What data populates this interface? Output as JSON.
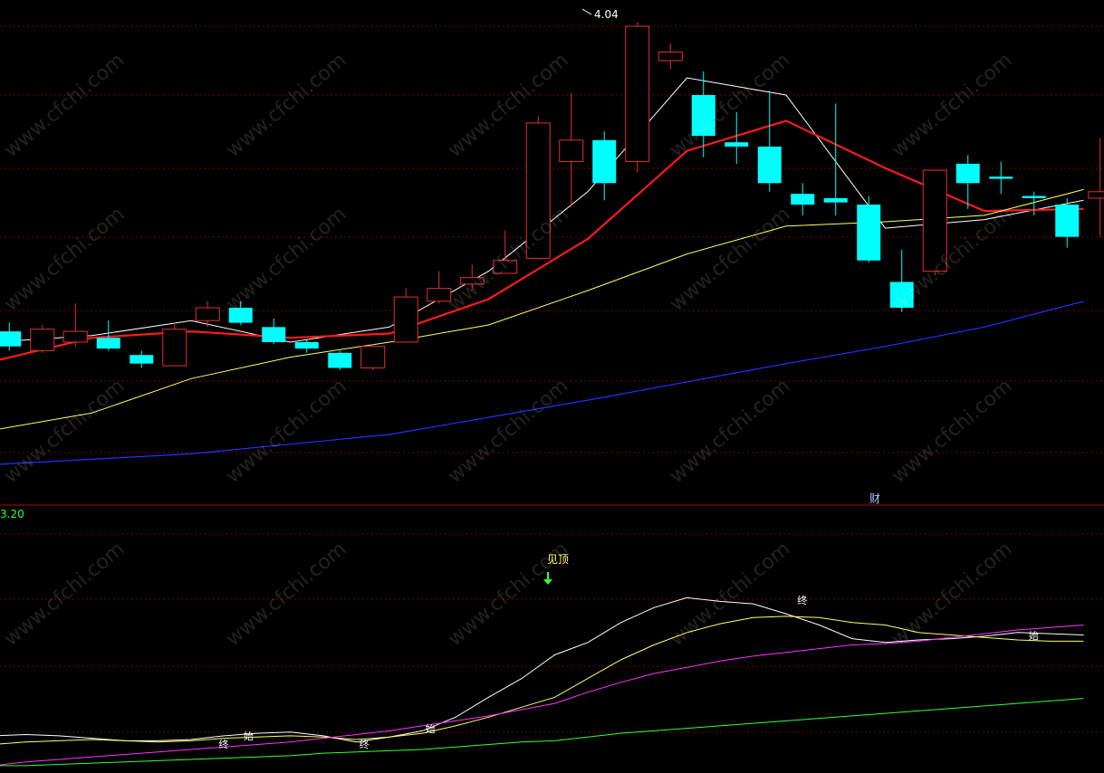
{
  "colors": {
    "up": "#e03030",
    "down": "#00ffff",
    "ma5": "#ffffff",
    "ma10": "#ff1a1a",
    "ma20": "#ffff66",
    "ma60": "#2233ff",
    "sub_white": "#ffffff",
    "sub_yellow": "#ffff66",
    "sub_magenta": "#ff33ff",
    "sub_green": "#33ff33",
    "grid": "#7a0000",
    "divider": "#c00000"
  },
  "labels": {
    "peak": "4.04",
    "sub_value": "3.20",
    "caibao": "财",
    "jianding": "见顶",
    "watermark": "www.cfchi.com"
  },
  "signal_marks": [
    {
      "text": "终",
      "x": 14,
      "y": 0.9
    },
    {
      "text": "始",
      "x": 15.5,
      "y": 0.96
    },
    {
      "text": "终",
      "x": 22.5,
      "y": 0.9
    },
    {
      "text": "始",
      "x": 26.5,
      "y": 1.02
    },
    {
      "text": "终",
      "x": 49,
      "y": 2.05
    },
    {
      "text": "始",
      "x": 63,
      "y": 1.77
    }
  ],
  "chart_data": [
    {
      "type": "candlestick",
      "title": "",
      "x": [
        0,
        1,
        2,
        3,
        4,
        5,
        6,
        7,
        8,
        9,
        10,
        11,
        12,
        13,
        14,
        15,
        16,
        17,
        18,
        19,
        20,
        21,
        22,
        23,
        24,
        25,
        26,
        27,
        28,
        29,
        30,
        31,
        32,
        33,
        34,
        35,
        36,
        37,
        38,
        39,
        40,
        41,
        42,
        43,
        44,
        45,
        46,
        47,
        48,
        49,
        50,
        51,
        52,
        53,
        54,
        55,
        56,
        57,
        58,
        59,
        60,
        61,
        62,
        63,
        64,
        65
      ],
      "ylim": [
        1.8,
        4.1
      ],
      "highlight": {
        "label": "4.04",
        "x": 35,
        "value": 4.04
      },
      "candles": [
        {
          "x": 1,
          "open": 2.6,
          "close": 2.53,
          "high": 2.64,
          "low": 2.51
        },
        {
          "x": 3,
          "open": 2.51,
          "close": 2.61,
          "high": 2.63,
          "low": 2.5
        },
        {
          "x": 5,
          "open": 2.55,
          "close": 2.6,
          "high": 2.73,
          "low": 2.53
        },
        {
          "x": 7,
          "open": 2.57,
          "close": 2.52,
          "high": 2.65,
          "low": 2.51
        },
        {
          "x": 9,
          "open": 2.49,
          "close": 2.45,
          "high": 2.51,
          "low": 2.43
        },
        {
          "x": 11,
          "open": 2.44,
          "close": 2.61,
          "high": 2.64,
          "low": 2.44
        },
        {
          "x": 13,
          "open": 2.65,
          "close": 2.71,
          "high": 2.74,
          "low": 2.62
        },
        {
          "x": 15,
          "open": 2.71,
          "close": 2.64,
          "high": 2.74,
          "low": 2.63
        },
        {
          "x": 17,
          "open": 2.62,
          "close": 2.55,
          "high": 2.66,
          "low": 2.54
        },
        {
          "x": 19,
          "open": 2.55,
          "close": 2.52,
          "high": 2.56,
          "low": 2.5
        },
        {
          "x": 21,
          "open": 2.5,
          "close": 2.43,
          "high": 2.51,
          "low": 2.42
        },
        {
          "x": 23,
          "open": 2.43,
          "close": 2.53,
          "high": 2.54,
          "low": 2.42
        },
        {
          "x": 25,
          "open": 2.55,
          "close": 2.76,
          "high": 2.8,
          "low": 2.55
        },
        {
          "x": 27,
          "open": 2.74,
          "close": 2.8,
          "high": 2.88,
          "low": 2.73
        },
        {
          "x": 29,
          "open": 2.82,
          "close": 2.85,
          "high": 2.91,
          "low": 2.79
        },
        {
          "x": 31,
          "open": 2.87,
          "close": 2.93,
          "high": 3.07,
          "low": 2.87
        },
        {
          "x": 33,
          "open": 2.94,
          "close": 3.57,
          "high": 3.6,
          "low": 2.94
        },
        {
          "x": 35,
          "open": 3.39,
          "close": 3.49,
          "high": 3.71,
          "low": 3.18
        },
        {
          "x": 37,
          "open": 3.49,
          "close": 3.29,
          "high": 3.53,
          "low": 3.21
        },
        {
          "x": 39,
          "open": 3.39,
          "close": 4.02,
          "high": 4.04,
          "low": 3.34
        },
        {
          "x": 41,
          "open": 3.86,
          "close": 3.9,
          "high": 3.94,
          "low": 3.82
        },
        {
          "x": 43,
          "open": 3.7,
          "close": 3.51,
          "high": 3.81,
          "low": 3.41
        },
        {
          "x": 45,
          "open": 3.48,
          "close": 3.46,
          "high": 3.62,
          "low": 3.38
        },
        {
          "x": 47,
          "open": 3.46,
          "close": 3.29,
          "high": 3.72,
          "low": 3.25
        },
        {
          "x": 49,
          "open": 3.24,
          "close": 3.19,
          "high": 3.29,
          "low": 3.14
        },
        {
          "x": 51,
          "open": 3.22,
          "close": 3.2,
          "high": 3.66,
          "low": 3.14
        },
        {
          "x": 53,
          "open": 3.19,
          "close": 2.93,
          "high": 3.23,
          "low": 2.92
        },
        {
          "x": 55,
          "open": 2.83,
          "close": 2.71,
          "high": 2.98,
          "low": 2.69
        },
        {
          "x": 57,
          "open": 2.88,
          "close": 3.35,
          "high": 3.35,
          "low": 2.86
        },
        {
          "x": 59,
          "open": 3.38,
          "close": 3.29,
          "high": 3.42,
          "low": 3.17
        },
        {
          "x": 61,
          "open": 3.32,
          "close": 3.31,
          "high": 3.39,
          "low": 3.24
        },
        {
          "x": 63,
          "open": 3.23,
          "close": 3.22,
          "high": 3.25,
          "low": 3.14
        },
        {
          "x": 65,
          "open": 3.19,
          "close": 3.04,
          "high": 3.22,
          "low": 2.99
        },
        {
          "x": 67,
          "open": 3.22,
          "close": 3.25,
          "high": 3.5,
          "low": 3.04
        }
      ],
      "series": [
        {
          "key": "ma5",
          "x": [
            0,
            6,
            12,
            18,
            24,
            30,
            36,
            42,
            48,
            54,
            60,
            66
          ],
          "values": [
            2.55,
            2.58,
            2.65,
            2.55,
            2.62,
            2.88,
            3.25,
            3.78,
            3.7,
            3.08,
            3.12,
            3.21
          ]
        },
        {
          "key": "ma10",
          "x": [
            0,
            6,
            12,
            18,
            24,
            30,
            36,
            42,
            48,
            54,
            60,
            66
          ],
          "values": [
            2.46,
            2.57,
            2.6,
            2.57,
            2.59,
            2.75,
            3.03,
            3.44,
            3.58,
            3.36,
            3.16,
            3.17
          ]
        },
        {
          "key": "ma20",
          "x": [
            0,
            6,
            12,
            18,
            24,
            30,
            36,
            42,
            48,
            54,
            60,
            66
          ],
          "values": [
            2.14,
            2.22,
            2.38,
            2.48,
            2.55,
            2.63,
            2.79,
            2.96,
            3.09,
            3.11,
            3.14,
            3.26
          ]
        },
        {
          "key": "ma60",
          "x": [
            0,
            12,
            24,
            36,
            48,
            54,
            60,
            66
          ],
          "values": [
            1.98,
            2.03,
            2.12,
            2.28,
            2.45,
            2.53,
            2.62,
            2.74
          ]
        }
      ]
    },
    {
      "type": "line",
      "title": "",
      "ylim": [
        0.7,
        2.7
      ],
      "x": [
        0,
        2,
        4,
        6,
        8,
        10,
        12,
        14,
        16,
        18,
        20,
        22,
        24,
        26,
        28,
        30,
        32,
        34,
        36,
        38,
        40,
        42,
        44,
        46,
        48,
        50,
        52,
        54,
        56,
        58,
        60,
        62,
        64,
        66
      ],
      "series": [
        {
          "key": "sub_white",
          "values": [
            0.97,
            0.98,
            0.97,
            0.95,
            0.93,
            0.93,
            0.94,
            0.97,
            0.99,
            1.0,
            0.97,
            0.92,
            0.96,
            1.01,
            1.12,
            1.28,
            1.43,
            1.62,
            1.72,
            1.88,
            2.0,
            2.08,
            2.05,
            2.03,
            1.95,
            1.86,
            1.75,
            1.72,
            1.74,
            1.75,
            1.77,
            1.8,
            1.79,
            1.78
          ]
        },
        {
          "key": "sub_yellow",
          "values": [
            0.9,
            0.92,
            0.93,
            0.94,
            0.93,
            0.92,
            0.93,
            0.95,
            0.96,
            0.97,
            0.96,
            0.94,
            0.96,
            0.99,
            1.05,
            1.12,
            1.2,
            1.28,
            1.43,
            1.58,
            1.7,
            1.8,
            1.87,
            1.92,
            1.93,
            1.92,
            1.88,
            1.86,
            1.8,
            1.78,
            1.76,
            1.74,
            1.73,
            1.73
          ]
        },
        {
          "key": "sub_magenta",
          "values": [
            0.73,
            0.76,
            0.78,
            0.8,
            0.82,
            0.84,
            0.86,
            0.88,
            0.9,
            0.92,
            0.95,
            0.98,
            1.01,
            1.05,
            1.09,
            1.13,
            1.18,
            1.23,
            1.32,
            1.4,
            1.47,
            1.52,
            1.57,
            1.61,
            1.64,
            1.67,
            1.7,
            1.71,
            1.73,
            1.76,
            1.79,
            1.82,
            1.84,
            1.86
          ]
        },
        {
          "key": "sub_green",
          "values": [
            0.73,
            0.73,
            0.74,
            0.75,
            0.76,
            0.77,
            0.78,
            0.79,
            0.8,
            0.81,
            0.83,
            0.84,
            0.85,
            0.86,
            0.88,
            0.9,
            0.92,
            0.93,
            0.96,
            0.99,
            1.01,
            1.03,
            1.05,
            1.07,
            1.09,
            1.11,
            1.13,
            1.15,
            1.17,
            1.19,
            1.21,
            1.23,
            1.25,
            1.27
          ]
        }
      ]
    }
  ]
}
